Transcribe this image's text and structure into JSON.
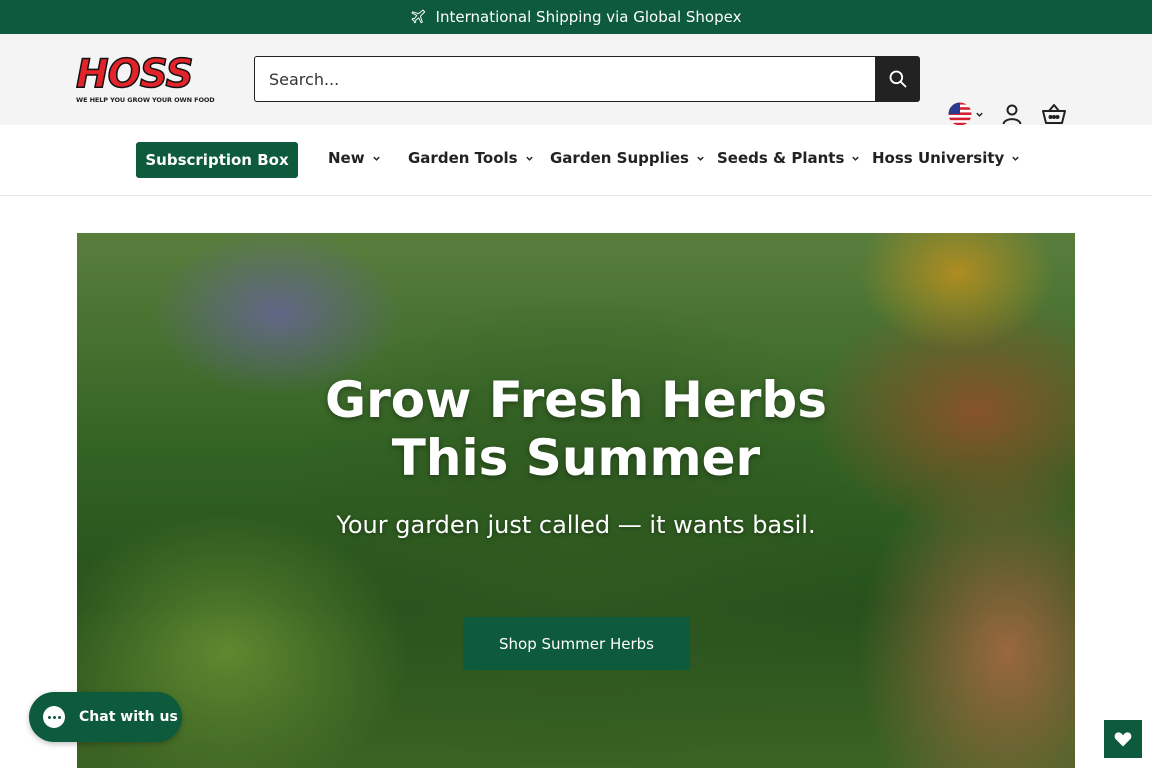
{
  "announcement": {
    "text": "International Shipping via Global Shopex"
  },
  "logo": {
    "word": "HOSS",
    "tagline": "WE HELP YOU GROW YOUR OWN FOOD"
  },
  "search": {
    "placeholder": "Search..."
  },
  "nav": {
    "subscription": "Subscription Box",
    "items": [
      "New",
      "Garden Tools",
      "Garden Supplies",
      "Seeds & Plants",
      "Hoss University"
    ]
  },
  "hero": {
    "title": "Grow Fresh Herbs This Summer",
    "subtitle": "Your garden just called — it wants basil.",
    "cta": "Shop Summer Herbs"
  },
  "chat": {
    "label": "Chat with us"
  },
  "colors": {
    "brand_green": "#0d5a3c",
    "logo_red": "#e3232a"
  },
  "icons": [
    "plane-icon",
    "search-icon",
    "us-flag-icon",
    "chevron-down-icon",
    "account-icon",
    "cart-icon",
    "chat-bubble-icon",
    "heart-icon"
  ]
}
